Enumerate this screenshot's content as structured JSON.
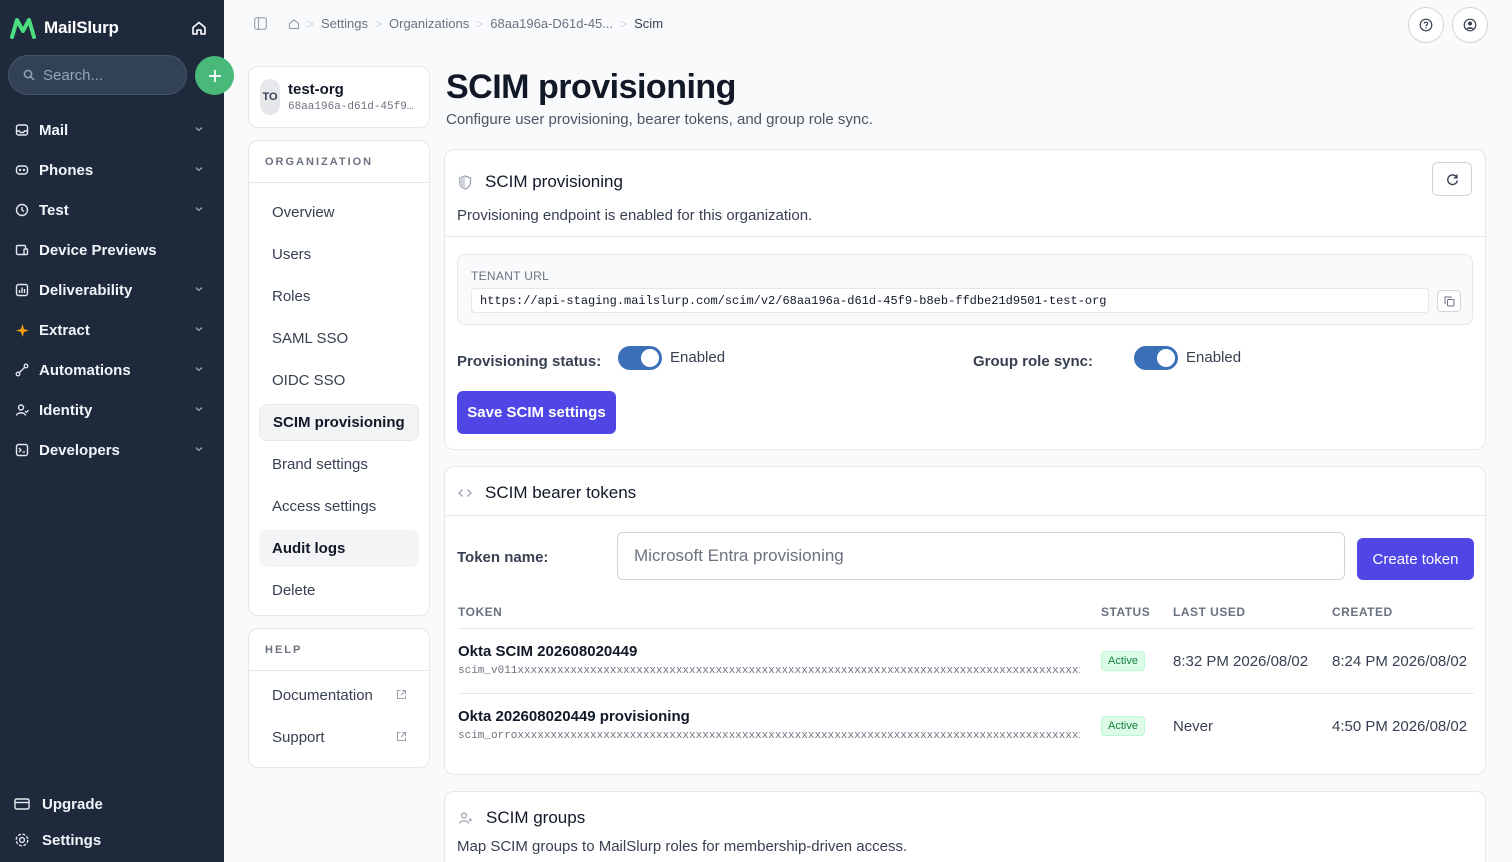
{
  "app": {
    "name": "MailSlurp"
  },
  "search": {
    "placeholder": "Search..."
  },
  "nav": [
    {
      "label": "Mail",
      "icon": "inbox-icon",
      "chevron": true
    },
    {
      "label": "Phones",
      "icon": "phone-icon",
      "chevron": true
    },
    {
      "label": "Test",
      "icon": "clock-icon",
      "chevron": true
    },
    {
      "label": "Device Previews",
      "icon": "device-icon",
      "chevron": false
    },
    {
      "label": "Deliverability",
      "icon": "chart-icon",
      "chevron": true
    },
    {
      "label": "Extract",
      "icon": "sparkle-icon",
      "chevron": true
    },
    {
      "label": "Automations",
      "icon": "flow-icon",
      "chevron": true
    },
    {
      "label": "Identity",
      "icon": "user-icon",
      "chevron": true
    },
    {
      "label": "Developers",
      "icon": "terminal-icon",
      "chevron": true
    }
  ],
  "sidebar_bottom": {
    "upgrade": "Upgrade",
    "settings": "Settings"
  },
  "breadcrumb": [
    "Settings",
    "Organizations",
    "68aa196a-D61d-45...",
    "Scim"
  ],
  "org": {
    "initials": "TO",
    "name": "test-org",
    "id": "68aa196a-d61d-45f9-b8eb-ffdbe21d9501"
  },
  "org_menu": {
    "heading": "ORGANIZATION",
    "items": [
      "Overview",
      "Users",
      "Roles",
      "SAML SSO",
      "OIDC SSO",
      "SCIM provisioning",
      "Brand settings",
      "Access settings",
      "Audit logs",
      "Delete"
    ]
  },
  "help_menu": {
    "heading": "HELP",
    "items": [
      "Documentation",
      "Support"
    ]
  },
  "page": {
    "title": "SCIM provisioning",
    "subtitle": "Configure user provisioning, bearer tokens, and group role sync."
  },
  "provisioning": {
    "title": "SCIM provisioning",
    "description": "Provisioning endpoint is enabled for this organization.",
    "tenant_label": "TENANT URL",
    "tenant_url": "https://api-staging.mailslurp.com/scim/v2/68aa196a-d61d-45f9-b8eb-ffdbe21d9501-test-org",
    "status_label": "Provisioning status:",
    "status_value": "Enabled",
    "status_on": true,
    "sync_label": "Group role sync:",
    "sync_value": "Enabled",
    "sync_on": true,
    "save_label": "Save SCIM settings"
  },
  "tokens": {
    "title": "SCIM bearer tokens",
    "name_label": "Token name:",
    "name_placeholder": "Microsoft Entra provisioning",
    "create_label": "Create token",
    "columns": [
      "TOKEN",
      "STATUS",
      "LAST USED",
      "CREATED"
    ],
    "rows": [
      {
        "name": "Okta SCIM 202608020449",
        "value": "scim_v011xxxxxxxxxxxxxxxxxxxxxxxxxxxxxxxxxxxxxxxxxxxxxxxxxxxxxxxxxxxxxxxxxxxxxxxxxxxxxxxxxxxxxxxxxx",
        "status": "Active",
        "last_used": "8:32 PM 2026/08/02",
        "created": "8:24 PM 2026/08/02"
      },
      {
        "name": "Okta 202608020449 provisioning",
        "value": "scim_orroxxxxxxxxxxxxxxxxxxxxxxxxxxxxxxxxxxxxxxxxxxxxxxxxxxxxxxxxxxxxxxxxxxxxxxxxxxxxxxxxxxxxxxxxxx",
        "status": "Active",
        "last_used": "Never",
        "created": "4:50 PM 2026/08/02"
      }
    ]
  },
  "groups": {
    "title": "SCIM groups",
    "description": "Map SCIM groups to MailSlurp roles for membership-driven access."
  },
  "colors": {
    "sidebar": "#1e293b",
    "primary": "#4f46e5",
    "toggle": "#3b6fb8",
    "add": "#49b97a"
  }
}
